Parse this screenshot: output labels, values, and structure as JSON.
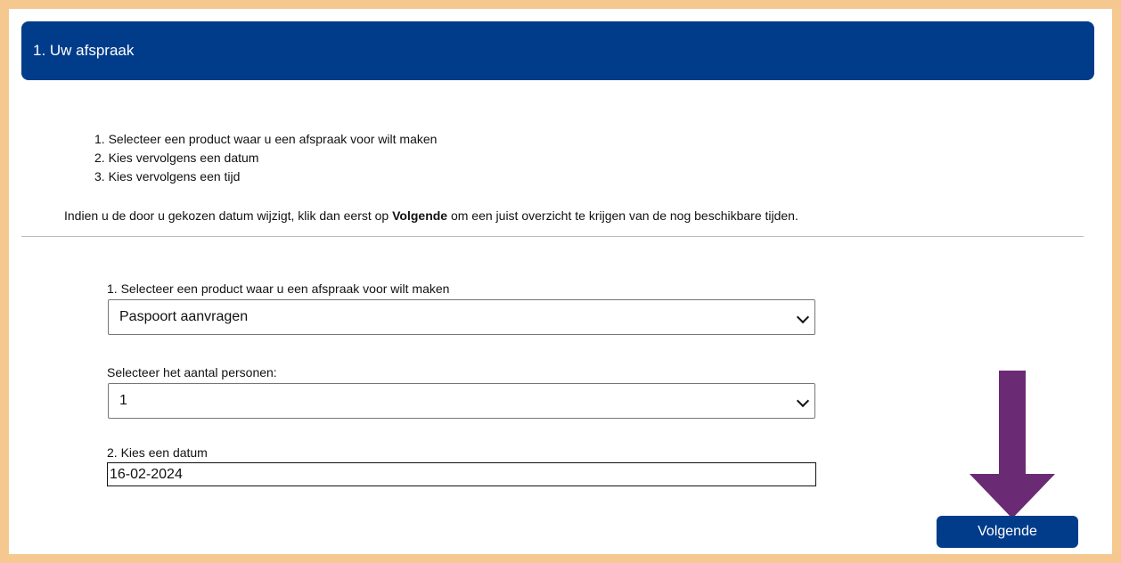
{
  "header": {
    "title": "1. Uw afspraak"
  },
  "instructions": {
    "steps": [
      "1. Selecteer een product waar u een afspraak voor wilt maken",
      "2. Kies vervolgens een datum",
      "3. Kies vervolgens een tijd"
    ],
    "info_prefix": "Indien u de door u gekozen datum wijzigt, klik dan eerst op ",
    "info_bold": "Volgende",
    "info_suffix": " om een juist overzicht te krijgen van de nog beschikbare tijden."
  },
  "form": {
    "product_label": "1. Selecteer een product waar u een afspraak voor wilt maken",
    "product_value": "Paspoort aanvragen",
    "persons_label": "Selecteer het aantal personen:",
    "persons_value": "1",
    "date_label": "2. Kies een datum",
    "date_value": "16-02-2024"
  },
  "actions": {
    "next_label": "Volgende"
  },
  "colors": {
    "header": "#003c8a",
    "frame": "#f5c890",
    "arrow": "#6b2a74"
  },
  "icons": {
    "select_arrow": "chevron-down-icon",
    "annotation": "down-arrow-icon"
  }
}
